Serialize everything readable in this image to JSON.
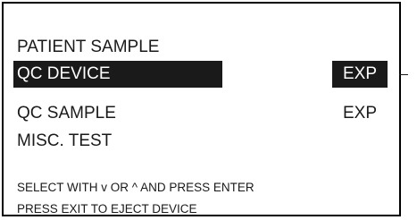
{
  "menu": {
    "items": [
      {
        "label": "PATIENT SAMPLE",
        "status": ""
      },
      {
        "label": "QC DEVICE",
        "status": "EXP"
      },
      {
        "label": "QC SAMPLE",
        "status": "EXP"
      },
      {
        "label": "MISC. TEST",
        "status": ""
      }
    ],
    "selected_index": 1
  },
  "instructions": {
    "line1": "SELECT WITH v OR ^ AND PRESS ENTER",
    "line2": "PRESS EXIT TO EJECT DEVICE"
  },
  "colors": {
    "highlight_bg": "#1a1a1a",
    "highlight_fg": "#ffffff",
    "text": "#1a1a1a",
    "background": "#ffffff"
  }
}
